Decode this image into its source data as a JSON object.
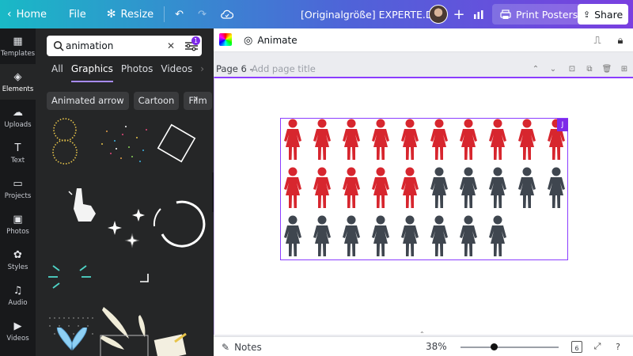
{
  "topbar": {
    "home_label": "Home",
    "file_label": "File",
    "resize_label": "Resize",
    "doc_title": "[Originalgröße] EXPERTE.DE",
    "print_label": "Print Posters",
    "share_label": "Share",
    "plus_symbol": "+"
  },
  "rail": {
    "items": [
      {
        "label": "Templates",
        "icon": "templates-icon"
      },
      {
        "label": "Elements",
        "icon": "elements-icon"
      },
      {
        "label": "Uploads",
        "icon": "uploads-icon"
      },
      {
        "label": "Text",
        "icon": "text-icon"
      },
      {
        "label": "Projects",
        "icon": "folder-icon"
      },
      {
        "label": "Photos",
        "icon": "photos-icon"
      },
      {
        "label": "Styles",
        "icon": "styles-icon"
      },
      {
        "label": "Audio",
        "icon": "audio-icon"
      },
      {
        "label": "Videos",
        "icon": "videos-icon"
      }
    ]
  },
  "panel": {
    "search_value": "animation",
    "filter_badge": "1",
    "tabs": [
      "All",
      "Graphics",
      "Photos",
      "Videos"
    ],
    "active_tab": "Graphics",
    "chips": [
      "Animated arrow",
      "Cartoon",
      "Film"
    ]
  },
  "toolbar": {
    "animate_label": "Animate"
  },
  "page": {
    "label": "Page 6 -",
    "title_placeholder": "Add page title",
    "selection_tag": "J"
  },
  "figure_grid": {
    "rows": 3,
    "cols": 10,
    "red_count": 15,
    "gray_count": 13,
    "colors": {
      "red": "#d7262e",
      "gray": "#3f464f"
    }
  },
  "bottom": {
    "notes_label": "Notes",
    "zoom": "38%",
    "page_count": "6"
  },
  "colors": {
    "accent": "#8b3dff",
    "panel_bg": "#252627",
    "rail_bg": "#18191b"
  }
}
